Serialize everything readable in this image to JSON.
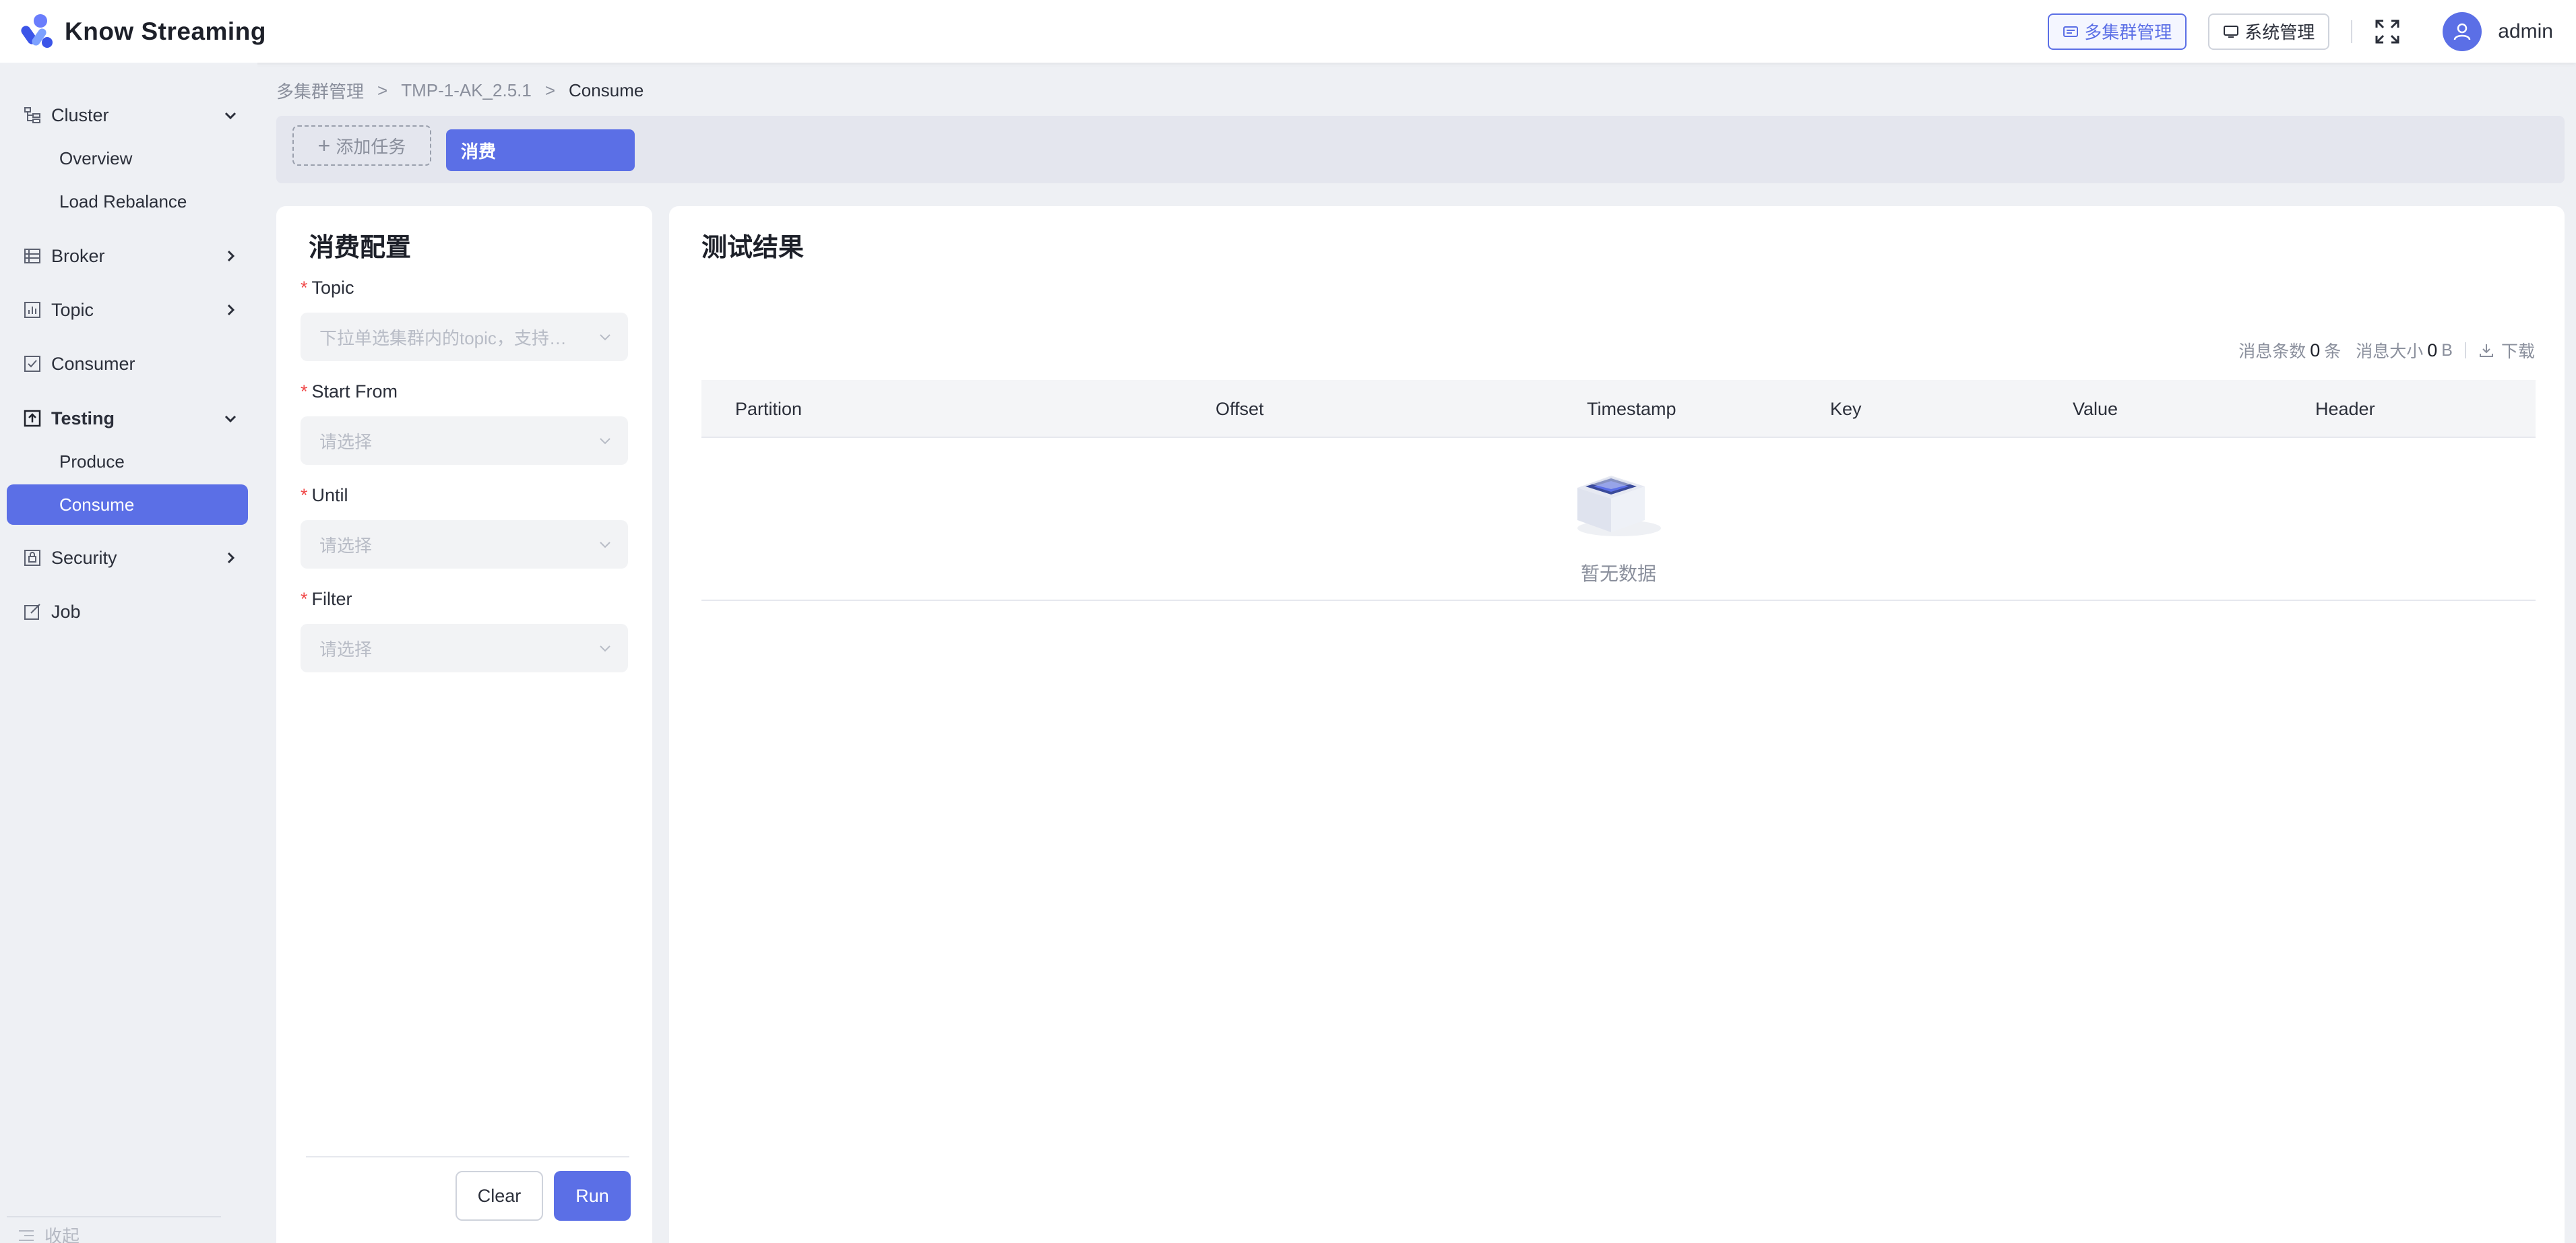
{
  "app": {
    "title": "Know Streaming"
  },
  "header": {
    "multi_cluster_label": "多集群管理",
    "system_label": "系统管理",
    "username": "admin"
  },
  "breadcrumb": {
    "items": [
      "多集群管理",
      "TMP-1-AK_2.5.1",
      "Consume"
    ],
    "separator": ">"
  },
  "sidebar": {
    "groups": [
      {
        "label": "Cluster",
        "icon": "cluster-icon",
        "expanded": true,
        "children": [
          "Overview",
          "Load Rebalance"
        ]
      },
      {
        "label": "Broker",
        "icon": "broker-icon",
        "expanded": false
      },
      {
        "label": "Topic",
        "icon": "topic-icon",
        "expanded": false
      },
      {
        "label": "Consumer",
        "icon": "consumer-icon"
      },
      {
        "label": "Testing",
        "icon": "testing-icon",
        "expanded": true,
        "children": [
          "Produce",
          "Consume"
        ]
      },
      {
        "label": "Security",
        "icon": "security-icon",
        "expanded": false
      },
      {
        "label": "Job",
        "icon": "job-icon"
      }
    ],
    "active_item": "Consume",
    "collapse_label": "收起"
  },
  "taskbar": {
    "add_task_label": "添加任务",
    "tabs": [
      "消费"
    ]
  },
  "config": {
    "title": "消费配置",
    "fields": [
      {
        "label": "Topic",
        "placeholder": "下拉单选集群内的topic，支持模糊搜索",
        "required": true
      },
      {
        "label": "Start From",
        "placeholder": "请选择",
        "required": true
      },
      {
        "label": "Until",
        "placeholder": "请选择",
        "required": true
      },
      {
        "label": "Filter",
        "placeholder": "请选择",
        "required": true
      }
    ],
    "clear_label": "Clear",
    "run_label": "Run"
  },
  "results": {
    "title": "测试结果",
    "count_label": "消息条数",
    "count_value": "0",
    "count_unit": "条",
    "size_label": "消息大小",
    "size_value": "0",
    "size_unit": "B",
    "download_label": "下载",
    "columns": [
      "Partition",
      "Offset",
      "Timestamp",
      "Key",
      "Value",
      "Header"
    ],
    "empty_text": "暂无数据"
  },
  "colors": {
    "accent": "#5b6fe6",
    "required": "#f04848",
    "background": "#eef0f4"
  }
}
